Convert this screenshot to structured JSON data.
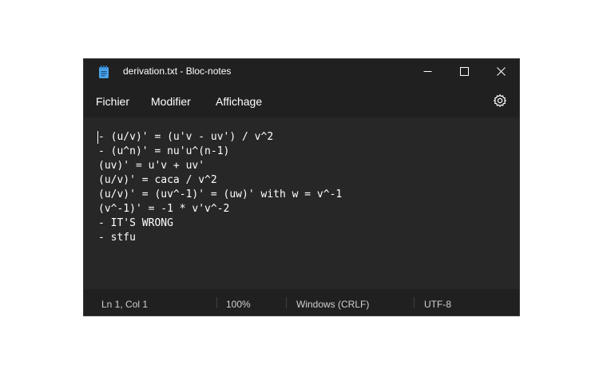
{
  "window": {
    "title": "derivation.txt - Bloc-notes",
    "controls": [
      "minimize",
      "maximize",
      "close"
    ]
  },
  "menu": {
    "items": [
      "Fichier",
      "Modifier",
      "Affichage"
    ],
    "settings_icon": "gear-icon"
  },
  "editor": {
    "lines": [
      "- (u/v)' = (u'v - uv') / v^2",
      "- (u^n)' = nu'u^(n-1)",
      "(uv)' = u'v + uv'",
      "(u/v)' = caca / v^2",
      "(u/v)' = (uv^-1)' = (uw)' with w = v^-1",
      "(v^-1)' = -1 * v'v^-2",
      "- IT'S WRONG",
      "- stfu"
    ]
  },
  "status": {
    "position": "Ln 1, Col 1",
    "zoom": "100%",
    "line_ending": "Windows (CRLF)",
    "encoding": "UTF-8"
  },
  "colors": {
    "background": "#202020",
    "editor_background": "#272727",
    "text": "#ffffff",
    "app_icon": "#4aa3e8"
  }
}
